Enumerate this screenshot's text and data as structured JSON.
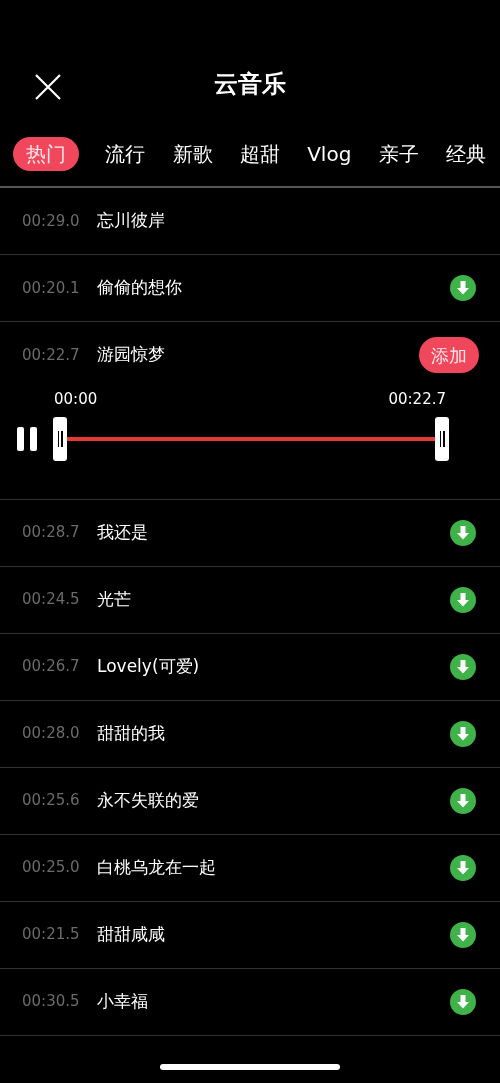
{
  "header": {
    "title": "云音乐"
  },
  "tabs": [
    {
      "label": "热门",
      "selected": true
    },
    {
      "label": "流行",
      "selected": false
    },
    {
      "label": "新歌",
      "selected": false
    },
    {
      "label": "超甜",
      "selected": false
    },
    {
      "label": "Vlog",
      "selected": false
    },
    {
      "label": "亲子",
      "selected": false
    },
    {
      "label": "经典",
      "selected": false
    }
  ],
  "tracks": [
    {
      "duration": "00:29.0",
      "title": "忘川彼岸",
      "kind": "plain"
    },
    {
      "duration": "00:20.1",
      "title": "偷偷的想你",
      "kind": "download"
    },
    {
      "duration": "00:22.7",
      "title": "游园惊梦",
      "kind": "add",
      "action_label": "添加",
      "player": {
        "playing": true,
        "start": "00:00",
        "end": "00:22.7"
      }
    },
    {
      "duration": "00:28.7",
      "title": "我还是",
      "kind": "download"
    },
    {
      "duration": "00:24.5",
      "title": "光芒",
      "kind": "download"
    },
    {
      "duration": "00:26.7",
      "title": "Lovely(可爱)",
      "kind": "download"
    },
    {
      "duration": "00:28.0",
      "title": "甜甜的我",
      "kind": "download"
    },
    {
      "duration": "00:25.6",
      "title": "永不失联的爱",
      "kind": "download"
    },
    {
      "duration": "00:25.0",
      "title": "白桃乌龙在一起",
      "kind": "download"
    },
    {
      "duration": "00:21.5",
      "title": "甜甜咸咸",
      "kind": "download"
    },
    {
      "duration": "00:30.5",
      "title": "小幸福",
      "kind": "download"
    }
  ]
}
